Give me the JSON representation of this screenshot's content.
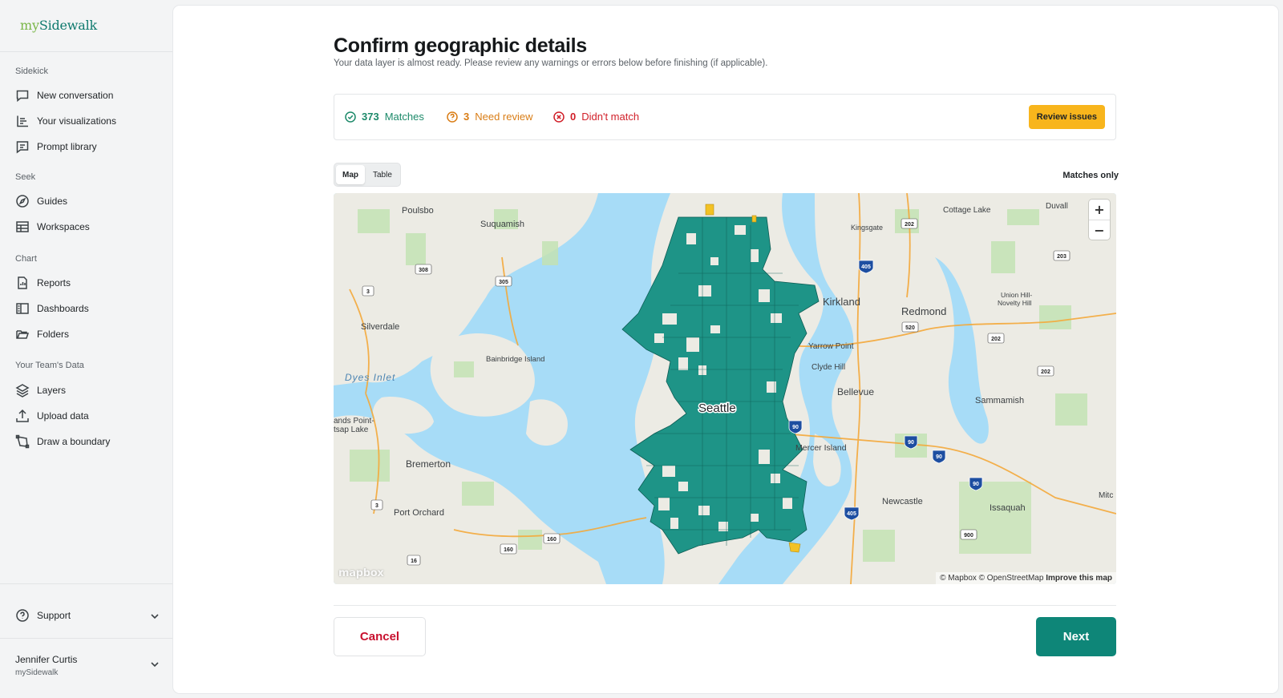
{
  "sidebar": {
    "logo": {
      "prefix": "my",
      "name": "Sidewalk"
    },
    "sections": [
      {
        "label": "Sidekick",
        "items": [
          {
            "label": "New conversation",
            "icon": "chat-bubble-icon"
          },
          {
            "label": "Your visualizations",
            "icon": "bar-chart-icon"
          },
          {
            "label": "Prompt library",
            "icon": "message-lines-icon"
          }
        ]
      },
      {
        "label": "Seek",
        "items": [
          {
            "label": "Guides",
            "icon": "compass-icon"
          },
          {
            "label": "Workspaces",
            "icon": "table-icon"
          }
        ]
      },
      {
        "label": "Chart",
        "items": [
          {
            "label": "Reports",
            "icon": "report-icon"
          },
          {
            "label": "Dashboards",
            "icon": "dashboard-icon"
          },
          {
            "label": "Folders",
            "icon": "folder-icon"
          }
        ]
      },
      {
        "label": "Your Team's Data",
        "items": [
          {
            "label": "Layers",
            "icon": "layers-icon"
          },
          {
            "label": "Upload data",
            "icon": "upload-icon"
          },
          {
            "label": "Draw a boundary",
            "icon": "draw-boundary-icon"
          }
        ]
      }
    ],
    "support": {
      "label": "Support",
      "icon": "help-circle-icon"
    },
    "user": {
      "name": "Jennifer Curtis",
      "org": "mySidewalk"
    }
  },
  "main": {
    "title": "Confirm geographic details",
    "subtitle": "Your data layer is almost ready. Please review any warnings or errors below before finishing (if applicable).",
    "status": {
      "matches": {
        "count": "373",
        "label": "Matches"
      },
      "need_review": {
        "count": "3",
        "label": "Need review"
      },
      "didnt_match": {
        "count": "0",
        "label": "Didn't match"
      }
    },
    "review_button": "Review issues",
    "view_toggle": {
      "map": "Map",
      "table": "Table",
      "active": "Map"
    },
    "filter_label": "Matches only",
    "map": {
      "labels": {
        "poulsbo": "Poulsbo",
        "suquamish": "Suquamish",
        "silverdale": "Silverdale",
        "bainbridge": "Bainbridge Island",
        "dyes_inlet": "Dyes Inlet",
        "sands_point_1": "ands Point-",
        "sands_point_2": "tsap Lake",
        "bremerton": "Bremerton",
        "port_orchard": "Port Orchard",
        "seattle": "Seattle",
        "kirkland": "Kirkland",
        "redmond": "Redmond",
        "kingsgate": "Kingsgate",
        "cottage_lake": "Cottage Lake",
        "duvall": "Duvall",
        "union_hill_1": "Union Hill-",
        "union_hill_2": "Novelty Hill",
        "yarrow_point": "Yarrow Point",
        "clyde_hill": "Clyde Hill",
        "bellevue": "Bellevue",
        "sammamish": "Sammamish",
        "mercer_island": "Mercer Island",
        "newcastle": "Newcastle",
        "issaquah": "Issaquah",
        "mitc": "Mitc"
      },
      "highway_shields": [
        "308",
        "3",
        "305",
        "202",
        "405",
        "203",
        "520",
        "202",
        "202",
        "90",
        "90",
        "90",
        "90",
        "405",
        "3",
        "160",
        "160",
        "16",
        "900"
      ],
      "attribution": "© Mapbox © OpenStreetMap",
      "improve_link": "Improve this map",
      "logo": "mapbox",
      "colors": {
        "water": "#a7dcf7",
        "land": "#ecebe4",
        "match_fill": "#1e9487",
        "review_fill": "#f3c224"
      }
    },
    "cancel_button": "Cancel",
    "next_button": "Next"
  }
}
